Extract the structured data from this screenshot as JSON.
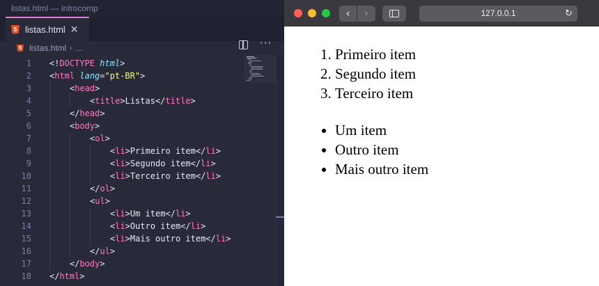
{
  "editor": {
    "window_title": "listas.html — introcomp",
    "tab": {
      "label": "listas.html",
      "close": "✕",
      "badge": "5"
    },
    "actions": {
      "more": "···"
    },
    "breadcrumb": {
      "file": "listas.html",
      "separator": "›",
      "more": "..."
    },
    "lines": [
      {
        "n": "1",
        "indent": 0,
        "kind": "doctype",
        "parts": [
          "<!",
          "DOCTYPE",
          "html",
          ">"
        ]
      },
      {
        "n": "2",
        "indent": 0,
        "kind": "open-attr",
        "parts": [
          "<",
          "html",
          "lang",
          "=",
          "\"pt-BR\"",
          ">"
        ]
      },
      {
        "n": "3",
        "indent": 1,
        "kind": "open",
        "parts": [
          "<",
          "head",
          ">"
        ]
      },
      {
        "n": "4",
        "indent": 2,
        "kind": "inline",
        "parts": [
          "<",
          "title",
          ">",
          "Listas",
          "</",
          "title",
          ">"
        ]
      },
      {
        "n": "5",
        "indent": 1,
        "kind": "close",
        "parts": [
          "</",
          "head",
          ">"
        ]
      },
      {
        "n": "6",
        "indent": 1,
        "kind": "open",
        "parts": [
          "<",
          "body",
          ">"
        ]
      },
      {
        "n": "7",
        "indent": 2,
        "kind": "open",
        "parts": [
          "<",
          "ol",
          ">"
        ]
      },
      {
        "n": "8",
        "indent": 3,
        "kind": "inline",
        "parts": [
          "<",
          "li",
          ">",
          "Primeiro item",
          "</",
          "li",
          ">"
        ]
      },
      {
        "n": "9",
        "indent": 3,
        "kind": "inline",
        "parts": [
          "<",
          "li",
          ">",
          "Segundo item",
          "</",
          "li",
          ">"
        ]
      },
      {
        "n": "10",
        "indent": 3,
        "kind": "inline",
        "parts": [
          "<",
          "li",
          ">",
          "Terceiro item",
          "</",
          "li",
          ">"
        ]
      },
      {
        "n": "11",
        "indent": 2,
        "kind": "close",
        "parts": [
          "</",
          "ol",
          ">"
        ]
      },
      {
        "n": "12",
        "indent": 2,
        "kind": "open",
        "parts": [
          "<",
          "ul",
          ">"
        ]
      },
      {
        "n": "13",
        "indent": 3,
        "kind": "inline",
        "parts": [
          "<",
          "li",
          ">",
          "Um item",
          "</",
          "li",
          ">"
        ]
      },
      {
        "n": "14",
        "indent": 3,
        "kind": "inline",
        "parts": [
          "<",
          "li",
          ">",
          "Outro item",
          "</",
          "li",
          ">"
        ]
      },
      {
        "n": "15",
        "indent": 3,
        "kind": "inline",
        "parts": [
          "<",
          "li",
          ">",
          "Mais outro item",
          "</",
          "li",
          ">"
        ]
      },
      {
        "n": "16",
        "indent": 2,
        "kind": "close",
        "parts": [
          "</",
          "ul",
          ">"
        ]
      },
      {
        "n": "17",
        "indent": 1,
        "kind": "close",
        "parts": [
          "</",
          "body",
          ">"
        ]
      },
      {
        "n": "18",
        "indent": 0,
        "kind": "close",
        "parts": [
          "</",
          "html",
          ">"
        ]
      }
    ],
    "colors": {
      "background": "#282a3a",
      "tag": "#ff79c6",
      "attribute": "#8be9fd",
      "string": "#f1fa8c",
      "text": "#e6e8f5",
      "line_number": "#7a80a3",
      "tab_accent": "#e17bd0"
    }
  },
  "browser": {
    "address": "127.0.0.1",
    "back_icon": "‹",
    "forward_icon": "›",
    "reload_icon": "↻",
    "traffic_lights": {
      "close": "#fe5f57",
      "minimize": "#febc2e",
      "maximize": "#28c840"
    },
    "ordered_list": [
      "Primeiro item",
      "Segundo item",
      "Terceiro item"
    ],
    "unordered_list": [
      "Um item",
      "Outro item",
      "Mais outro item"
    ]
  }
}
